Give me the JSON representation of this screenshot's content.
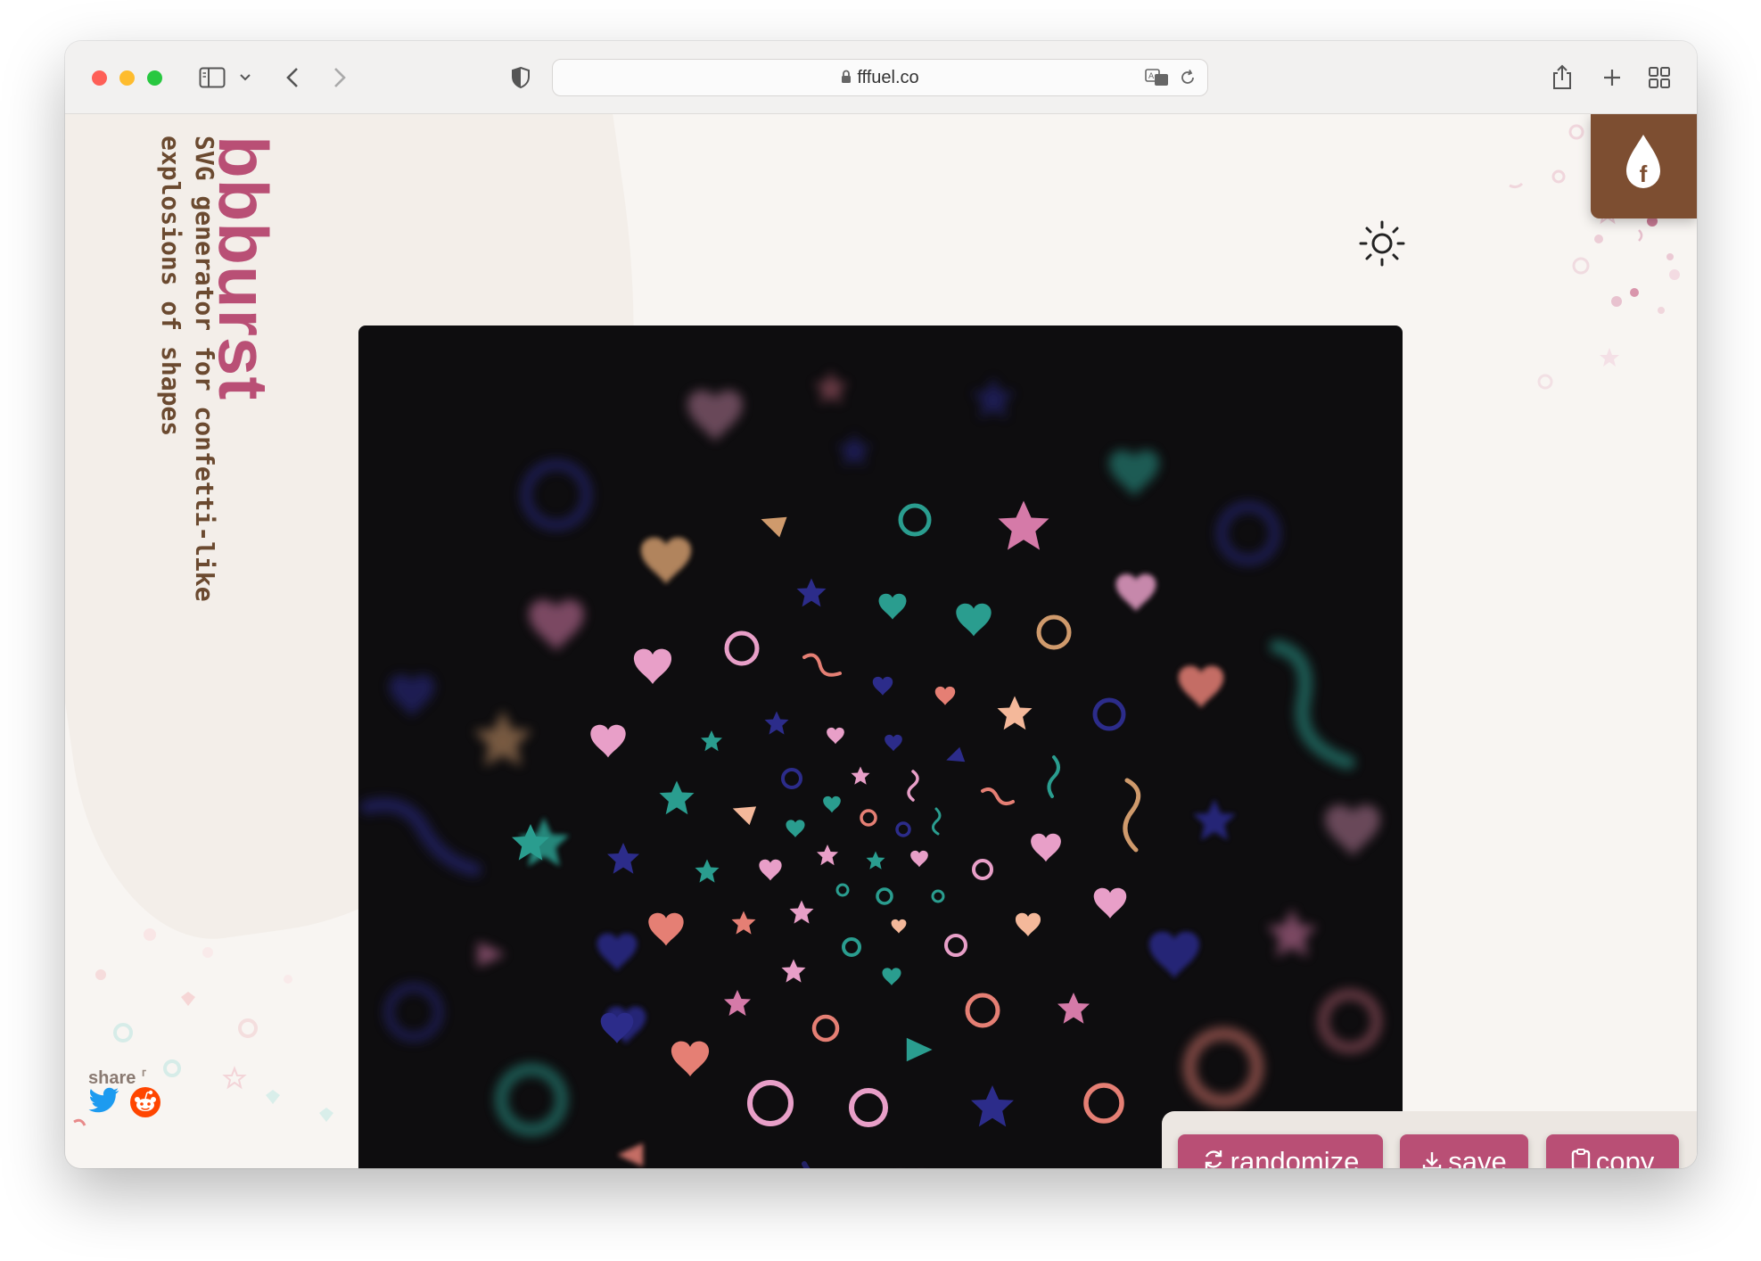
{
  "browser": {
    "url": "fffuel.co"
  },
  "app": {
    "title": "bbburst",
    "subtitle_line1": "SVG generator for confetti-like",
    "subtitle_line2": "explosions of shapes",
    "brand_letter": "f"
  },
  "actions": {
    "randomize_label": "randomize",
    "save_label": "save",
    "copy_label": "copy"
  },
  "share": {
    "label": "share",
    "targets": [
      "twitter-icon",
      "reddit-icon"
    ]
  },
  "colors": {
    "accent": "#b94f75",
    "brand_tab": "#7d4e31",
    "canvas_bg": "#0e0d0f",
    "page_bg": "#f8f5f2",
    "confetti": [
      "#e57f74",
      "#2a9d8f",
      "#f4a89f",
      "#e89fc8",
      "#2c2c8a",
      "#cf9a6c",
      "#d57aa8"
    ]
  },
  "icons": {
    "theme_toggle": "sun-icon",
    "randomize": "refresh-icon",
    "save": "download-icon",
    "copy": "clipboard-icon"
  }
}
